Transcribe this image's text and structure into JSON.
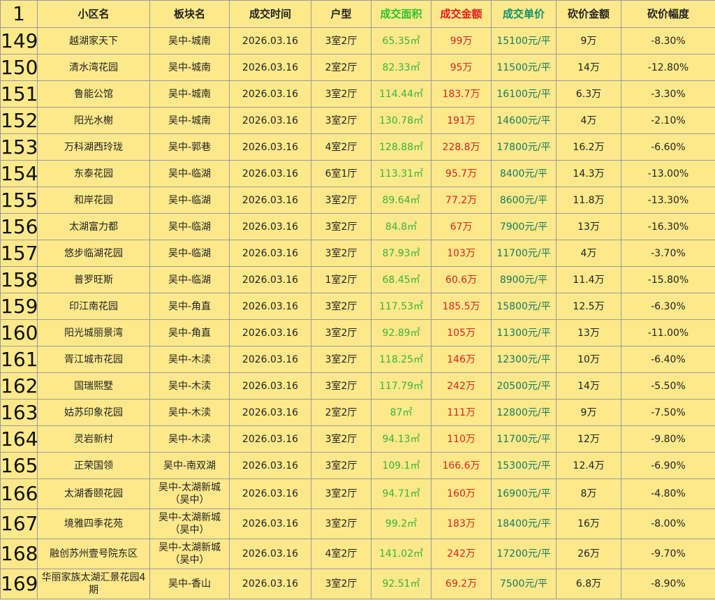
{
  "header": {
    "row_num": "1",
    "columns": [
      "小区名",
      "板块名",
      "成交时间",
      "户型",
      "成交面积",
      "成交金额",
      "成交单价",
      "砍价金额",
      "砍价幅度"
    ]
  },
  "rows": [
    {
      "n": "149",
      "name": "越湖家天下",
      "area": "吴中-城南",
      "date": "2026.03.16",
      "type": "3室2厅",
      "size": "65.35㎡",
      "total": "99万",
      "unit": "15100元/平",
      "cut": "9万",
      "pct": "-8.30%"
    },
    {
      "n": "150",
      "name": "清水湾花园",
      "area": "吴中-城南",
      "date": "2026.03.16",
      "type": "2室2厅",
      "size": "82.33㎡",
      "total": "95万",
      "unit": "11500元/平",
      "cut": "14万",
      "pct": "-12.80%"
    },
    {
      "n": "151",
      "name": "鲁能公馆",
      "area": "吴中-城南",
      "date": "2026.03.16",
      "type": "3室2厅",
      "size": "114.44㎡",
      "total": "183.7万",
      "unit": "16100元/平",
      "cut": "6.3万",
      "pct": "-3.30%"
    },
    {
      "n": "152",
      "name": "阳光水榭",
      "area": "吴中-城南",
      "date": "2026.03.16",
      "type": "3室2厅",
      "size": "130.78㎡",
      "total": "191万",
      "unit": "14600元/平",
      "cut": "4万",
      "pct": "-2.10%"
    },
    {
      "n": "153",
      "name": "万科湖西玲珑",
      "area": "吴中-郭巷",
      "date": "2026.03.16",
      "type": "4室2厅",
      "size": "128.88㎡",
      "total": "228.8万",
      "unit": "17800元/平",
      "cut": "16.2万",
      "pct": "-6.60%"
    },
    {
      "n": "154",
      "name": "东泰花园",
      "area": "吴中-临湖",
      "date": "2026.03.16",
      "type": "6室1厅",
      "size": "113.31㎡",
      "total": "95.7万",
      "unit": "8400元/平",
      "cut": "14.3万",
      "pct": "-13.00%"
    },
    {
      "n": "155",
      "name": "和岸花园",
      "area": "吴中-临湖",
      "date": "2026.03.16",
      "type": "3室2厅",
      "size": "89.64㎡",
      "total": "77.2万",
      "unit": "8600元/平",
      "cut": "11.8万",
      "pct": "-13.30%"
    },
    {
      "n": "156",
      "name": "太湖富力都",
      "area": "吴中-临湖",
      "date": "2026.03.16",
      "type": "3室2厅",
      "size": "84.8㎡",
      "total": "67万",
      "unit": "7900元/平",
      "cut": "13万",
      "pct": "-16.30%"
    },
    {
      "n": "157",
      "name": "悠步临湖花园",
      "area": "吴中-临湖",
      "date": "2026.03.16",
      "type": "3室2厅",
      "size": "87.93㎡",
      "total": "103万",
      "unit": "11700元/平",
      "cut": "4万",
      "pct": "-3.70%"
    },
    {
      "n": "158",
      "name": "普罗旺斯",
      "area": "吴中-临湖",
      "date": "2026.03.16",
      "type": "1室2厅",
      "size": "68.45㎡",
      "total": "60.6万",
      "unit": "8900元/平",
      "cut": "11.4万",
      "pct": "-15.80%"
    },
    {
      "n": "159",
      "name": "印江南花园",
      "area": "吴中-角直",
      "date": "2026.03.16",
      "type": "3室2厅",
      "size": "117.53㎡",
      "total": "185.5万",
      "unit": "15800元/平",
      "cut": "12.5万",
      "pct": "-6.30%"
    },
    {
      "n": "160",
      "name": "阳光城丽景湾",
      "area": "吴中-角直",
      "date": "2026.03.16",
      "type": "3室2厅",
      "size": "92.89㎡",
      "total": "105万",
      "unit": "11300元/平",
      "cut": "13万",
      "pct": "-11.00%"
    },
    {
      "n": "161",
      "name": "胥江城市花园",
      "area": "吴中-木渎",
      "date": "2026.03.16",
      "type": "3室2厅",
      "size": "118.25㎡",
      "total": "146万",
      "unit": "12300元/平",
      "cut": "10万",
      "pct": "-6.40%"
    },
    {
      "n": "162",
      "name": "国瑞熙墅",
      "area": "吴中-木渎",
      "date": "2026.03.16",
      "type": "3室2厅",
      "size": "117.79㎡",
      "total": "242万",
      "unit": "20500元/平",
      "cut": "14万",
      "pct": "-5.50%"
    },
    {
      "n": "163",
      "name": "姑苏印象花园",
      "area": "吴中-木渎",
      "date": "2026.03.16",
      "type": "2室2厅",
      "size": "87㎡",
      "total": "111万",
      "unit": "12800元/平",
      "cut": "9万",
      "pct": "-7.50%"
    },
    {
      "n": "164",
      "name": "灵岩新村",
      "area": "吴中-木渎",
      "date": "2026.03.16",
      "type": "3室2厅",
      "size": "94.13㎡",
      "total": "110万",
      "unit": "11700元/平",
      "cut": "12万",
      "pct": "-9.80%"
    },
    {
      "n": "165",
      "name": "正荣国领",
      "area": "吴中-南双湖",
      "date": "2026.03.16",
      "type": "3室2厅",
      "size": "109.1㎡",
      "total": "166.6万",
      "unit": "15300元/平",
      "cut": "12.4万",
      "pct": "-6.90%"
    },
    {
      "n": "166",
      "name": "太湖香颐花园",
      "area": "吴中-太湖新城（吴中）",
      "date": "2026.03.16",
      "type": "3室2厅",
      "size": "94.71㎡",
      "total": "160万",
      "unit": "16900元/平",
      "cut": "8万",
      "pct": "-4.80%"
    },
    {
      "n": "167",
      "name": "境雅四季花苑",
      "area": "吴中-太湖新城（吴中）",
      "date": "2026.03.16",
      "type": "3室2厅",
      "size": "99.2㎡",
      "total": "183万",
      "unit": "18400元/平",
      "cut": "16万",
      "pct": "-8.00%"
    },
    {
      "n": "168",
      "name": "融创苏州壹号院东区",
      "area": "吴中-太湖新城（吴中）",
      "date": "2026.03.16",
      "type": "4室2厅",
      "size": "141.02㎡",
      "total": "242万",
      "unit": "17200元/平",
      "cut": "26万",
      "pct": "-9.70%"
    },
    {
      "n": "169",
      "name": "华丽家族太湖汇景花园4期",
      "area": "吴中-香山",
      "date": "2026.03.16",
      "type": "3室2厅",
      "size": "92.51㎡",
      "total": "69.2万",
      "unit": "7500元/平",
      "cut": "6.8万",
      "pct": "-8.90%"
    }
  ]
}
